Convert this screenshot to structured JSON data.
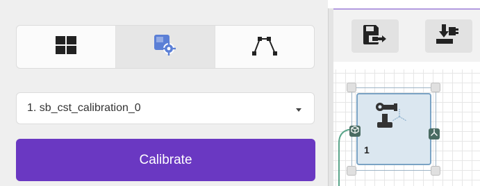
{
  "left_panel": {
    "tabs": [
      {
        "name": "tab-grid",
        "icon": "grid-icon",
        "active": false
      },
      {
        "name": "tab-calibration-settings",
        "icon": "calibration-settings-icon",
        "active": true
      },
      {
        "name": "tab-path",
        "icon": "path-icon",
        "active": false
      }
    ],
    "select": {
      "value": "1. sb_cst_calibration_0"
    },
    "calibrate_button": {
      "label": "Calibrate"
    }
  },
  "toolbar": {
    "buttons": [
      {
        "name": "save-export-button",
        "icon": "save-export-icon"
      },
      {
        "name": "import-button",
        "icon": "import-icon"
      }
    ]
  },
  "canvas": {
    "node": {
      "label": "1",
      "icon": "robot-arm-icon"
    }
  },
  "colors": {
    "accent": "#6a38c2",
    "tab_icon_active": "#5b7fd6",
    "node_fill": "#dbe7f0",
    "port": "#4a6b62"
  }
}
